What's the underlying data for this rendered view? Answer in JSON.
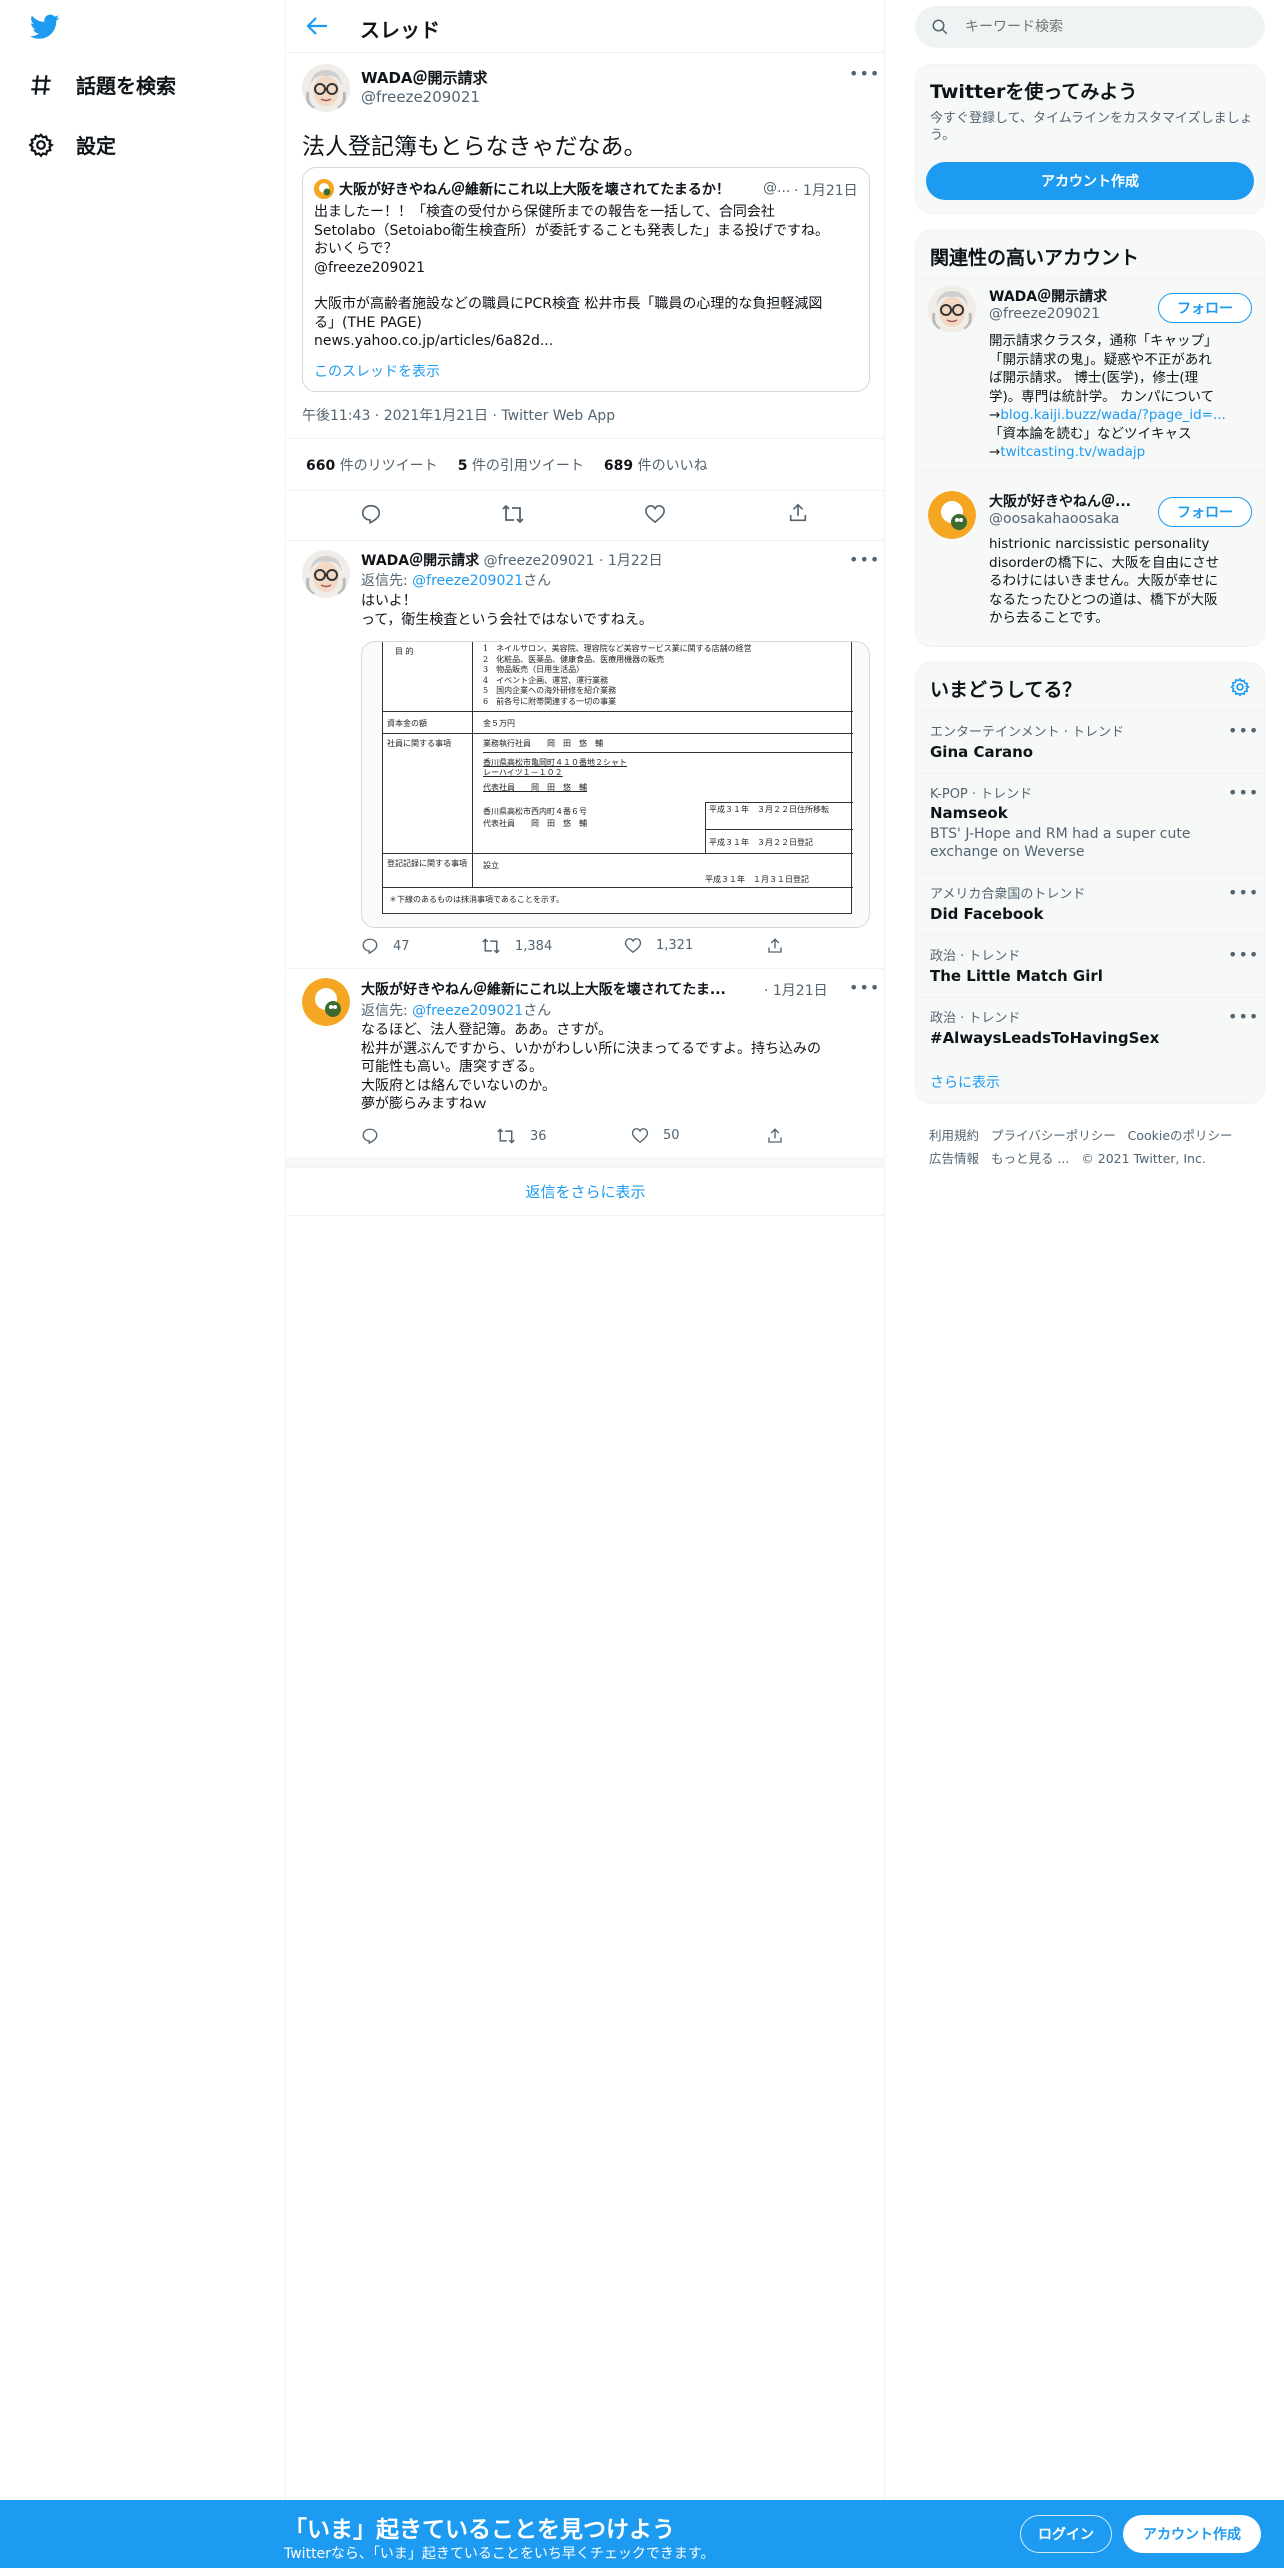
{
  "nav": {
    "explore": "話題を検索",
    "settings": "設定"
  },
  "header": {
    "title": "スレッド"
  },
  "main_tweet": {
    "name": "WADA＠開示請求",
    "handle": "@freeze209021",
    "text": "法人登記簿もとらなきゃだなあ。",
    "quote": {
      "name": "大阪が好きやねん＠維新にこれ以上大阪を壊されてたまるか！",
      "handle_trunc": "@...",
      "date": "1月21日",
      "line1": "出ましたー！！「検査の受付から保健所までの報告を一括して、合同会社",
      "line2": "Setolabo（Setoiabo衛生検査所）が委託することも発表した」まる投げですね。",
      "line3": "おいくらで？",
      "line4": "@freeze209021",
      "line5": "大阪市が高齢者施設などの職員にPCR検査 松井市長「職員の心理的な負担軽減図",
      "line6": "る」(THE PAGE)",
      "line7": "news.yahoo.co.jp/articles/6a82d...",
      "show_thread": "このスレッドを表示"
    },
    "meta": "午後11:43 · 2021年1月21日 · Twitter Web App",
    "retweets_num": "660",
    "retweets_label": "件のリツイート",
    "quotes_num": "5",
    "quotes_label": "件の引用ツイート",
    "likes_num": "689",
    "likes_label": "件のいいね"
  },
  "reply1": {
    "name": "WADA＠開示請求",
    "handle": "@freeze209021",
    "date": "· 1月22日",
    "reply_prefix": "返信先: ",
    "reply_to": "@freeze209021",
    "reply_suffix": "さん",
    "line1": "はいよ！",
    "line2": "って，衛生検査という会社ではないですねえ。",
    "doc": {
      "purpose": "目 的",
      "items": [
        "1　ネイルサロン、美容院、理容院など美容サービス業に関する店舗の経営",
        "2　化粧品、医薬品、健康食品、医療用機器の販売",
        "3　物品販売（日用生活品）",
        "4　イベント企画、運営、運行業務",
        "5　国内企業への海外研修を紹介業務",
        "6　前各号に附帯関連する一切の事業"
      ],
      "capital_label": "資本金の額",
      "capital_value": "金５万円",
      "officer_label": "社員に関する事項",
      "officer_role1": "業務執行社員　　岡　田　悠　輔",
      "officer_addr": "香川県高松市亀岡町４１０番地２シャトレーハイツ１－１０２",
      "officer_role2": "代表社員　　岡　田　悠　輔",
      "officer_addr2": "香川県高松市西内町４番６号",
      "officer_role3": "代表社員　　岡　田　悠　輔",
      "date_a1": "平成３１年　３月２２日住所移転",
      "date_a2": "平成３１年　３月２２日登記",
      "record_label": "登記記録に関する事項",
      "record_value": "設立",
      "record_date": "平成３１年　１月３１日登記",
      "footnote": "＊下線のあるものは抹消事項であることを示す。"
    },
    "replies": "47",
    "retweets": "1,384",
    "likes": "1,321"
  },
  "reply2": {
    "name": "大阪が好きやねん＠維新にこれ以上大阪を壊されてたま...",
    "date": "· 1月21日",
    "reply_prefix": "返信先: ",
    "reply_to": "@freeze209021",
    "reply_suffix": "さん",
    "line1": "なるほど、法人登記簿。ああ。さすが。",
    "line2": "松井が選ぶんですから、いかがわしい所に決まってるですよ。持ち込みの",
    "line3": "可能性も高い。唐突すぎる。",
    "line4": "大阪府とは絡んでいないのか。",
    "line5": "夢が膨らみますねｗ",
    "retweets": "36",
    "likes": "50"
  },
  "show_more_replies": "返信をさらに表示",
  "search": {
    "placeholder": "キーワード検索"
  },
  "signup_card": {
    "title": "Twitterを使ってみよう",
    "subtitle_l1": "今すぐ登録して、タイムラインをカスタマイズしましょ",
    "subtitle_l2": "う。",
    "button": "アカウント作成"
  },
  "relevant": {
    "title": "関連性の高いアカウント",
    "follow": "フォロー",
    "acc1": {
      "name": "WADA＠開示請求",
      "handle": "@freeze209021",
      "bio_l1": "開示請求クラスタ，通称「キャップ」",
      "bio_l2": "「開示請求の鬼」。疑惑や不正があれ",
      "bio_l3": "ば開示請求。 博士(医学)，修士(理",
      "bio_l4": "学)。専門は統計学。 カンパについて",
      "bio_l5a": "→",
      "bio_l5b": "blog.kaiji.buzz/wada/?page_id=...",
      "bio_l6": "「資本論を読む」などツイキャス",
      "bio_l7a": "→",
      "bio_l7b": "twitcasting.tv/wadajp"
    },
    "acc2": {
      "name": "大阪が好きやねん＠...",
      "handle": "@oosakahaoosaka",
      "bio_l1": "histrionic narcissistic personality",
      "bio_l2": "disorderの橋下に、大阪を自由にさせ",
      "bio_l3": "るわけにはいきません。大阪が幸せに",
      "bio_l4": "なるたったひとつの道は、橋下が大阪",
      "bio_l5": "から去ることです。"
    }
  },
  "trends": {
    "title": "いまどうしてる？",
    "items": [
      {
        "meta": "エンターテインメント · トレンド",
        "name": "Gina Carano",
        "sub": ""
      },
      {
        "meta": "K-POP · トレンド",
        "name": "Namseok",
        "sub_l1": "BTS' J-Hope and RM had a super cute",
        "sub_l2": "exchange on Weverse"
      },
      {
        "meta": "アメリカ合衆国のトレンド",
        "name": "Did Facebook",
        "sub": ""
      },
      {
        "meta": "政治 · トレンド",
        "name": "The Little Match Girl",
        "sub": ""
      },
      {
        "meta": "政治 · トレンド",
        "name": "#AlwaysLeadsToHavingSex",
        "sub": ""
      }
    ],
    "show_more": "さらに表示"
  },
  "footer": {
    "terms": "利用規約",
    "privacy": "プライバシーポリシー",
    "cookie": "Cookieのポリシー",
    "ads": "広告情報",
    "more": "もっと見る ...",
    "copyright": "© 2021 Twitter, Inc."
  },
  "bottom_bar": {
    "title": "「いま」起きていることを見つけよう",
    "subtitle": "Twitterなら、「いま」起きていることをいち早くチェックできます。",
    "login": "ログイン",
    "signup": "アカウント作成"
  },
  "colors": {
    "accent": "#1d9bf0",
    "text": "#0f1419",
    "secondary": "#536471",
    "border": "#eff3f4"
  }
}
